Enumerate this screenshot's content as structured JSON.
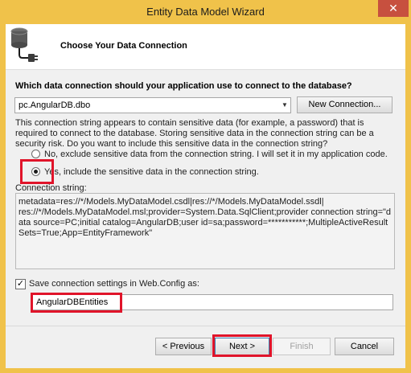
{
  "window": {
    "title": "Entity Data Model Wizard",
    "close_glyph": "✕"
  },
  "header": {
    "icon": "database-connection-icon",
    "heading": "Choose Your Data Connection"
  },
  "connection": {
    "question": "Which data connection should your application use to connect to the database?",
    "selected": "pc.AngularDB.dbo",
    "dropdown_glyph": "▼",
    "new_connection_label": "New Connection..."
  },
  "sensitive": {
    "paragraph": "This connection string appears to contain sensitive data (for example, a password) that is required to connect to the database. Storing sensitive data in the connection string can be a security risk. Do you want to include this sensitive data in the connection string?",
    "option_no": "No, exclude sensitive data from the connection string. I will set it in my application code.",
    "option_yes": "Yes, include the sensitive data in the connection string.",
    "selected_option": "yes"
  },
  "connection_string": {
    "label": "Connection string:",
    "value": "metadata=res://*/Models.MyDataModel.csdl|res://*/Models.MyDataModel.ssdl|\nres://*/Models.MyDataModel.msl;provider=System.Data.SqlClient;provider connection string=\"data source=PC;initial catalog=AngularDB;user id=sa;password=***********;MultipleActiveResultSets=True;App=EntityFramework\""
  },
  "save_settings": {
    "checked": true,
    "check_glyph": "✓",
    "label": "Save connection settings in Web.Config as:",
    "entity_name": "AngularDBEntities"
  },
  "buttons": {
    "previous": "< Previous",
    "next": "Next >",
    "finish": "Finish",
    "cancel": "Cancel"
  },
  "colors": {
    "title_bar": "#f0c24a",
    "close_button": "#c7503f",
    "highlight": "#e0142a"
  }
}
